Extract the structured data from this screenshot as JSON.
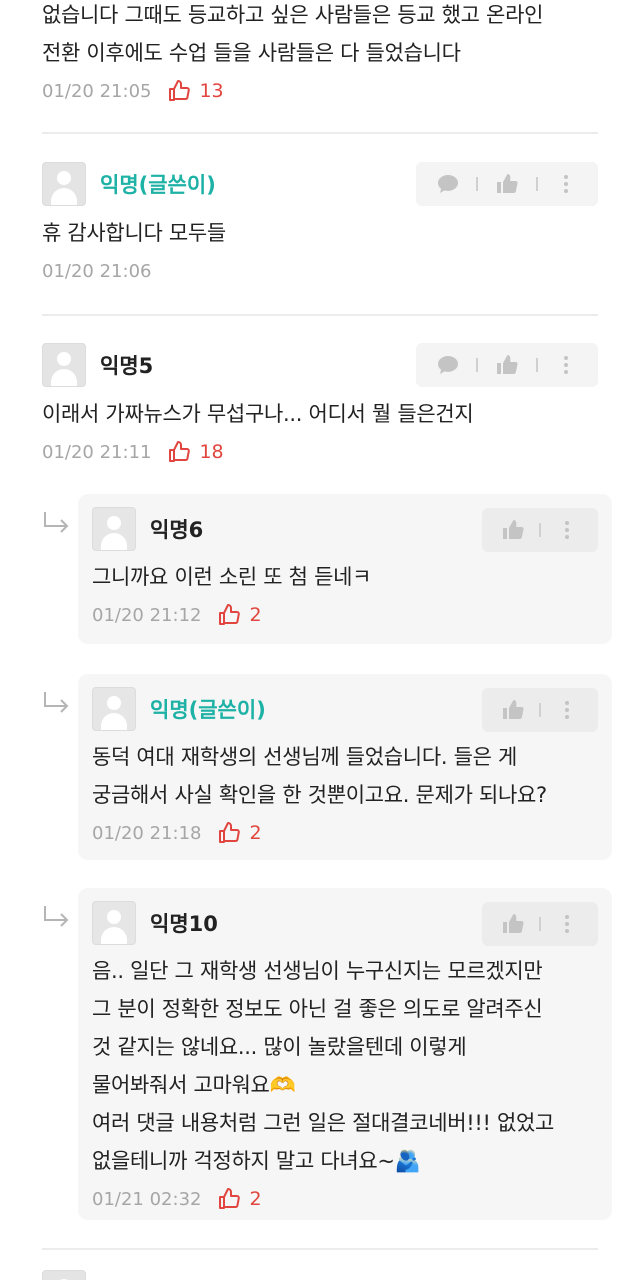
{
  "post_tail": {
    "lines": "없습니다 그때도 등교하고 싶은 사람들은 등교 했고 온라인\n전환 이후에도 수업 들을 사람들은 다 들었습니다",
    "time": "01/20 21:05",
    "likes": "13"
  },
  "comments": [
    {
      "author": "익명(글쓴이)",
      "text": "휴 감사합니다 모두들",
      "time": "01/20 21:06",
      "likes": ""
    },
    {
      "author": "익명5",
      "text": "이래서 가짜뉴스가 무섭구나... 어디서 뭘 들은건지",
      "time": "01/20 21:11",
      "likes": "18"
    }
  ],
  "replies": [
    {
      "author": "익명6",
      "text": "그니까요 이런 소린 또 첨 듣네ㅋ",
      "time": "01/20 21:12",
      "likes": "2"
    },
    {
      "author": "익명(글쓴이)",
      "text": "동덕 여대 재학생의 선생님께 들었습니다. 들은 게\n궁금해서 사실 확인을 한 것뿐이고요. 문제가 되나요?",
      "time": "01/20 21:18",
      "likes": "2"
    },
    {
      "author": "익명10",
      "text": "음.. 일단 그 재학생 선생님이 누구신지는 모르겠지만\n그 분이 정확한 정보도 아닌 걸 좋은 의도로 알려주신\n것 같지는 않네요... 많이 놀랐을텐데 이렇게\n물어봐줘서 고마워요🫶\n여러 댓글 내용처럼 그런 일은 절대결코네버!!! 없었고\n없을테니까 걱정하지 말고 다녀요~🫂",
      "time": "01/21 02:32",
      "likes": "2"
    }
  ],
  "icons": {
    "comment": "speech-bubble-icon",
    "like": "thumbs-up-icon",
    "more": "more-vertical-icon",
    "reply_arrow": "reply-arrow-icon",
    "like_count": "thumbs-up-outline-icon"
  },
  "colors": {
    "op_author": "#1eb2a6",
    "like_red": "#e0463f",
    "meta_gray": "#a6a6a6"
  }
}
